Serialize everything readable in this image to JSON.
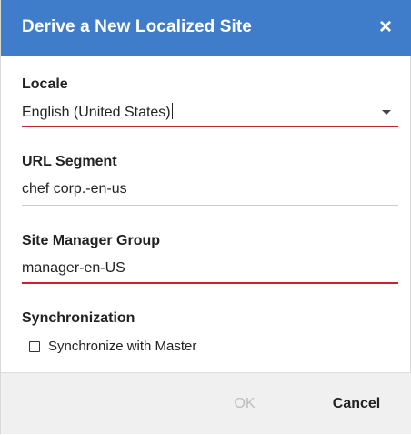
{
  "dialog": {
    "title": "Derive a New Localized Site",
    "close_label": "×"
  },
  "fields": {
    "locale": {
      "label": "Locale",
      "value": "English (United States)",
      "state": "error"
    },
    "url_segment": {
      "label": "URL Segment",
      "value": "chef corp.-en-us"
    },
    "site_manager_group": {
      "label": "Site Manager Group",
      "value": "manager-en-US",
      "state": "error"
    },
    "synchronization": {
      "label": "Synchronization",
      "checkbox_label": "Synchronize with Master",
      "checked": false
    }
  },
  "footer": {
    "ok_label": "OK",
    "ok_enabled": false,
    "cancel_label": "Cancel"
  },
  "colors": {
    "header": "#3f7cc9",
    "error": "#c8232c",
    "disabled_text": "#bdbdbd"
  }
}
